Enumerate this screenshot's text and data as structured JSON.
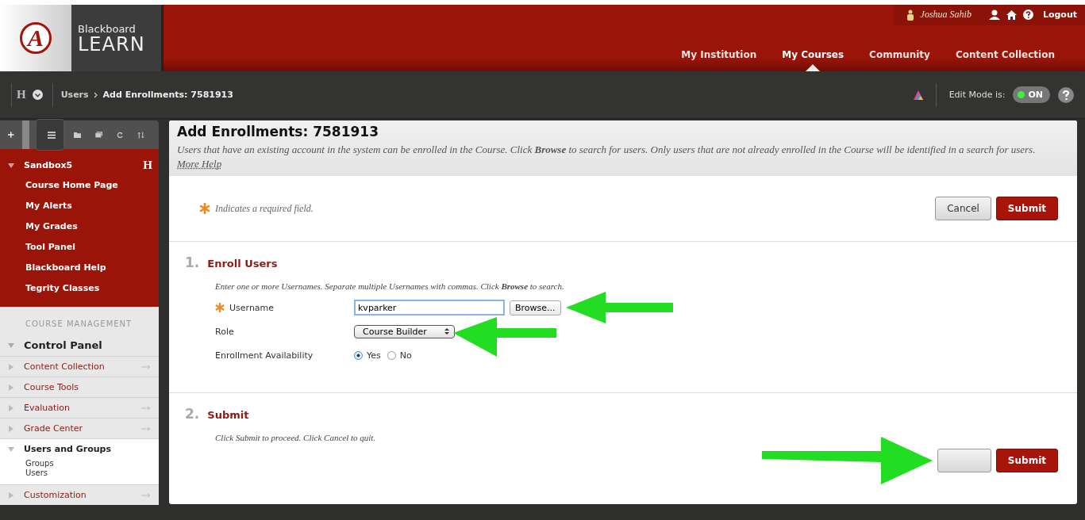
{
  "user_bar": {
    "user_name": "Joshua Sahib",
    "logout": "Logout"
  },
  "logo": {
    "mark": "A",
    "line1": "Blackboard",
    "line2": "LEARN"
  },
  "nav_tabs": [
    {
      "label": "My Institution",
      "selected": false
    },
    {
      "label": "My Courses",
      "selected": true
    },
    {
      "label": "Community",
      "selected": false
    },
    {
      "label": "Content Collection",
      "selected": false
    }
  ],
  "breadcrumb": {
    "course_mark": "H",
    "items": [
      "Users",
      "Add Enrollments: 7581913"
    ]
  },
  "edit_mode": {
    "label": "Edit Mode is:",
    "state": "ON",
    "on": true
  },
  "sidebar": {
    "course": {
      "title": "Sandbox5",
      "mark": "H",
      "expanded": true,
      "links": [
        "Course Home Page",
        "My Alerts",
        "My Grades",
        "Tool Panel",
        "Blackboard Help",
        "Tegrity Classes"
      ]
    },
    "section_heading": "COURSE MANAGEMENT",
    "control_panel": {
      "title": "Control Panel",
      "expanded": true,
      "items": [
        {
          "label": "Content Collection",
          "expanded": false,
          "arrow": true
        },
        {
          "label": "Course Tools",
          "expanded": false,
          "arrow": false
        },
        {
          "label": "Evaluation",
          "expanded": false,
          "arrow": true
        },
        {
          "label": "Grade Center",
          "expanded": false,
          "arrow": true
        },
        {
          "label": "Users and Groups",
          "expanded": true,
          "arrow": false,
          "children": [
            "Groups",
            "Users"
          ]
        },
        {
          "label": "Customization",
          "expanded": false,
          "arrow": true
        }
      ]
    }
  },
  "page": {
    "title": "Add Enrollments: 7581913",
    "description": "Users that have an existing account in the system can be enrolled in the Course. Click **Browse** to search for users. Only users that are not already enrolled in the Course will be identified in a search for users.",
    "more_help": "More Help",
    "required_note": "Indicates a required field.",
    "top_buttons": [
      {
        "kind": "cancel",
        "label": "Cancel"
      },
      {
        "kind": "submit",
        "label": "Submit"
      }
    ],
    "steps": [
      {
        "number": "1.",
        "title": "Enroll Users",
        "instructions": "Enter one or more Usernames. Separate multiple Usernames with commas. Click **Browse** to search.",
        "fields": [
          {
            "kind": "text",
            "label": "Username",
            "required": true,
            "value": "kvparker",
            "button": "Browse..."
          },
          {
            "kind": "select",
            "label": "Role",
            "required": false,
            "value": "Course Builder"
          },
          {
            "kind": "radio",
            "label": "Enrollment Availability",
            "required": false,
            "options": [
              {
                "label": "Yes",
                "selected": true
              },
              {
                "label": "No",
                "selected": false
              }
            ]
          }
        ]
      },
      {
        "number": "2.",
        "title": "Submit",
        "instructions": "Click Submit to proceed. Click Cancel to quit.",
        "buttons": [
          {
            "kind": "cancel"
          },
          {
            "kind": "submit",
            "label": "Submit"
          }
        ]
      }
    ]
  }
}
